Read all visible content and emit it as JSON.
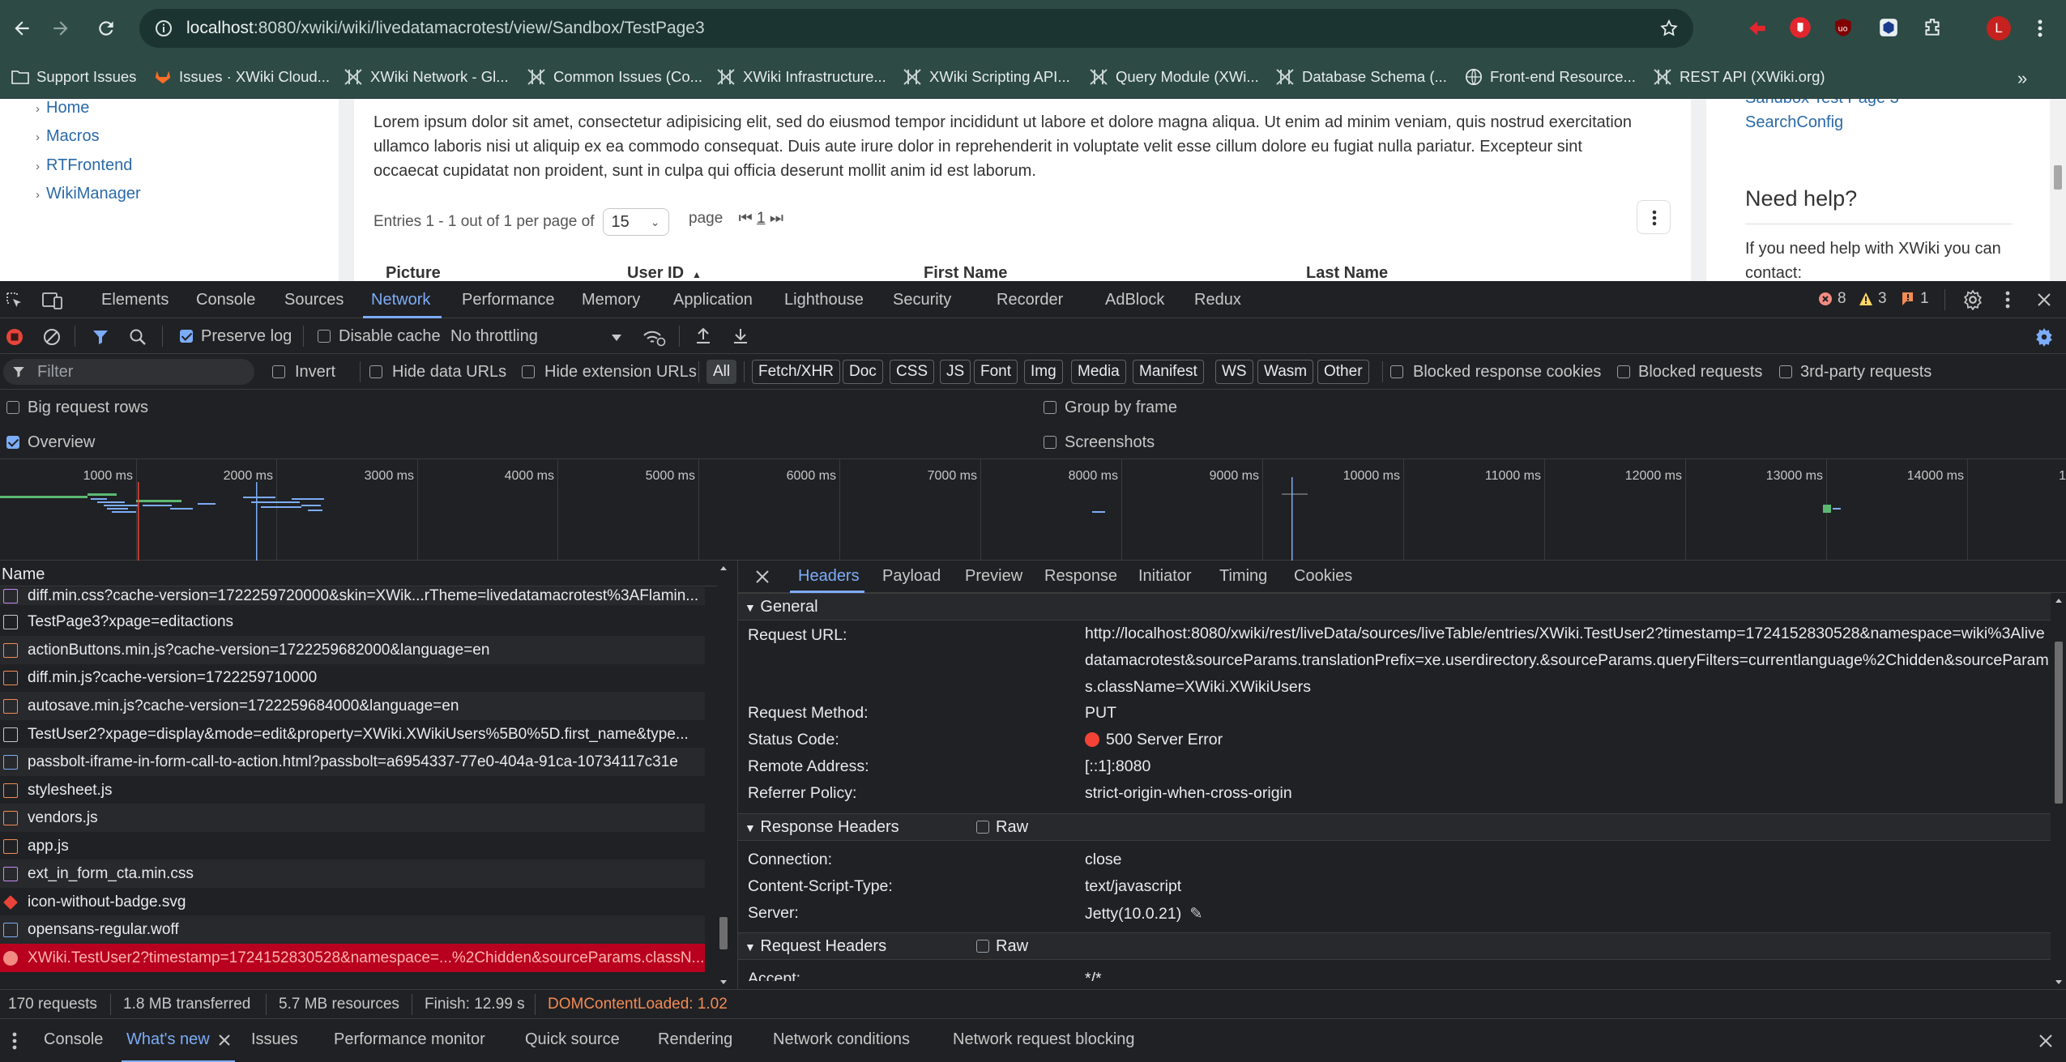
{
  "browser": {
    "url_host": "localhost",
    "url_path": ":8080/xwiki/wiki/livedatamacrotest/view/Sandbox/TestPage3",
    "avatar_letter": "L",
    "bookmarks": [
      "Support Issues",
      "Issues · XWiki Cloud...",
      "XWiki Network - Gl...",
      "Common Issues (Co...",
      "XWiki Infrastructure...",
      "XWiki Scripting API...",
      "Query Module (XWi...",
      "Database Schema (...",
      "Front-end Resource...",
      "REST API (XWiki.org)"
    ],
    "colors": {
      "chrome": "#2d4a45",
      "address_bar": "#1c3431"
    }
  },
  "page": {
    "nav": [
      "Home",
      "Macros",
      "RTFrontend",
      "WikiManager"
    ],
    "lorem": "Lorem ipsum dolor sit amet, consectetur adipisicing elit, sed do eiusmod tempor incididunt ut labore et dolore magna aliqua. Ut enim ad minim veniam, quis nostrud exercitation ullamco laboris nisi ut aliquip ex ea commodo consequat. Duis aute irure dolor in reprehenderit in voluptate velit esse cillum dolore eu fugiat nulla pariatur. Excepteur sint occaecat cupidatat non proident, sunt in culpa qui officia deserunt mollit anim id est laborum.",
    "entries_text": "Entries 1 - 1 out of 1 per page of",
    "per_page": "15",
    "page_label": "page",
    "page_number": "1",
    "columns": [
      "Picture",
      "User ID",
      "First Name",
      "Last Name"
    ],
    "right_links": [
      "Sandbox Test Page 3",
      "SearchConfig"
    ],
    "help_title": "Need help?",
    "help_text": "If you need help with XWiki you can contact:"
  },
  "devtools": {
    "tabs": [
      "Elements",
      "Console",
      "Sources",
      "Network",
      "Performance",
      "Memory",
      "Application",
      "Lighthouse",
      "Security",
      "Recorder",
      "AdBlock",
      "Redux"
    ],
    "active_tab": "Network",
    "errors": "8",
    "warnings": "3",
    "issues": "1",
    "toolbar": {
      "preserve_log": "Preserve log",
      "disable_cache": "Disable cache",
      "throttling": "No throttling"
    },
    "filter": {
      "placeholder": "Filter",
      "invert": "Invert",
      "hide_data_urls": "Hide data URLs",
      "hide_extension_urls": "Hide extension URLs",
      "types": [
        "All",
        "Fetch/XHR",
        "Doc",
        "CSS",
        "JS",
        "Font",
        "Img",
        "Media",
        "Manifest",
        "WS",
        "Wasm",
        "Other"
      ],
      "blocked_response_cookies": "Blocked response cookies",
      "blocked_requests": "Blocked requests",
      "third_party": "3rd-party requests"
    },
    "options": {
      "big_request_rows": "Big request rows",
      "group_by_frame": "Group by frame",
      "overview": "Overview",
      "screenshots": "Screenshots"
    },
    "timeline_ticks": [
      "1000 ms",
      "2000 ms",
      "3000 ms",
      "4000 ms",
      "5000 ms",
      "6000 ms",
      "7000 ms",
      "8000 ms",
      "9000 ms",
      "10000 ms",
      "11000 ms",
      "12000 ms",
      "13000 ms",
      "14000 ms",
      "1"
    ],
    "name_header": "Name",
    "requests": [
      {
        "name": "diff.min.css?cache-version=1722259720000&skin=XWik...rTheme=livedatamacrotest%3AFlamin...",
        "type": "css"
      },
      {
        "name": "TestPage3?xpage=editactions",
        "type": "doc"
      },
      {
        "name": "actionButtons.min.js?cache-version=1722259682000&language=en",
        "type": "js"
      },
      {
        "name": "diff.min.js?cache-version=1722259710000",
        "type": "js"
      },
      {
        "name": "autosave.min.js?cache-version=1722259684000&language=en",
        "type": "js"
      },
      {
        "name": "TestUser2?xpage=display&mode=edit&property=XWiki.XWikiUsers%5B0%5D.first_name&type...",
        "type": "doc"
      },
      {
        "name": "passbolt-iframe-in-form-call-to-action.html?passbolt=a6954337-77e0-404a-91ca-10734117c31e",
        "type": "html"
      },
      {
        "name": "stylesheet.js",
        "type": "js"
      },
      {
        "name": "vendors.js",
        "type": "js"
      },
      {
        "name": "app.js",
        "type": "js"
      },
      {
        "name": "ext_in_form_cta.min.css",
        "type": "css"
      },
      {
        "name": "icon-without-badge.svg",
        "type": "img"
      },
      {
        "name": "opensans-regular.woff",
        "type": "font"
      },
      {
        "name": "XWiki.TestUser2?timestamp=1724152830528&namespace=...%2Chidden&sourceParams.classN...",
        "type": "error"
      }
    ],
    "detail_tabs": [
      "Headers",
      "Payload",
      "Preview",
      "Response",
      "Initiator",
      "Timing",
      "Cookies"
    ],
    "general": {
      "title": "General",
      "request_url_label": "Request URL:",
      "request_url": "http://localhost:8080/xwiki/rest/liveData/sources/liveTable/entries/XWiki.TestUser2?timestamp=1724152830528&namespace=wiki%3Alivedatamacrotest&sourceParams.translationPrefix=xe.userdirectory.&sourceParams.queryFilters=currentlanguage%2Chidden&sourceParams.className=XWiki.XWikiUsers",
      "method_label": "Request Method:",
      "method": "PUT",
      "status_label": "Status Code:",
      "status": "500 Server Error",
      "remote_label": "Remote Address:",
      "remote": "[::1]:8080",
      "referrer_label": "Referrer Policy:",
      "referrer": "strict-origin-when-cross-origin"
    },
    "response_headers": {
      "title": "Response Headers",
      "raw": "Raw",
      "connection_label": "Connection:",
      "connection": "close",
      "cst_label": "Content-Script-Type:",
      "cst": "text/javascript",
      "server_label": "Server:",
      "server": "Jetty(10.0.21)"
    },
    "request_headers": {
      "title": "Request Headers",
      "raw": "Raw",
      "partial_label": "Accept:",
      "partial_value": "*/*"
    },
    "status_bar": {
      "requests": "170 requests",
      "transferred": "1.8 MB transferred",
      "resources": "5.7 MB resources",
      "finish": "Finish: 12.99 s",
      "dcl": "DOMContentLoaded: 1.02"
    },
    "drawer_tabs": [
      "Console",
      "What's new",
      "Issues",
      "Performance monitor",
      "Quick source",
      "Rendering",
      "Network conditions",
      "Network request blocking"
    ],
    "colors": {
      "accent": "#7cacf8",
      "error_row": "#b8001e",
      "status_dot": "#f44336",
      "dcl": "#f28b54"
    }
  }
}
